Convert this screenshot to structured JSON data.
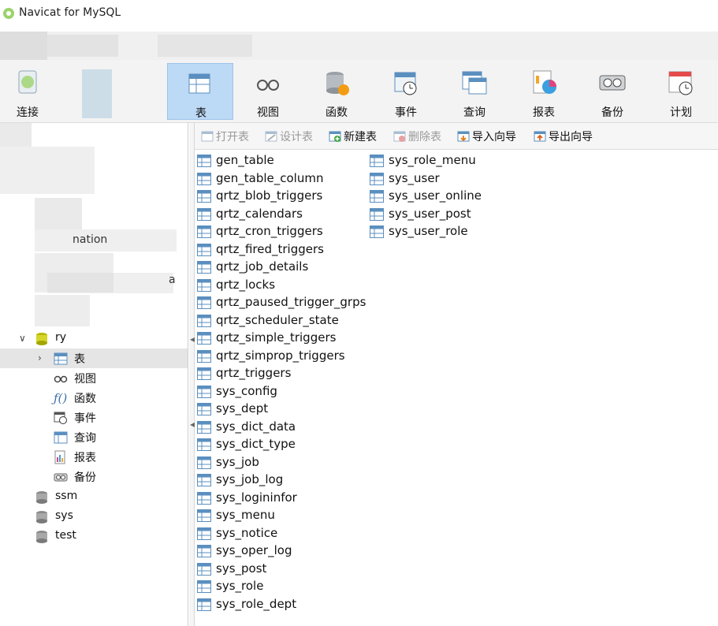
{
  "window": {
    "title": "Navicat for MySQL"
  },
  "toolbar": {
    "items": [
      {
        "label": "连接",
        "icon": "connection-icon"
      },
      {
        "label": "",
        "icon": "user-icon"
      },
      {
        "label": "表",
        "icon": "table-icon"
      },
      {
        "label": "视图",
        "icon": "view-icon"
      },
      {
        "label": "函数",
        "icon": "function-icon"
      },
      {
        "label": "事件",
        "icon": "event-icon"
      },
      {
        "label": "查询",
        "icon": "query-icon"
      },
      {
        "label": "报表",
        "icon": "report-icon"
      },
      {
        "label": "备份",
        "icon": "backup-icon"
      },
      {
        "label": "计划",
        "icon": "schedule-icon"
      }
    ]
  },
  "objbar": {
    "open": "打开表",
    "design": "设计表",
    "new": "新建表",
    "delete": "删除表",
    "import": "导入向导",
    "export": "导出向导"
  },
  "sidebar": {
    "partial_labels": [
      "nation",
      "a"
    ],
    "db_ry": "ry",
    "children": [
      {
        "label": "表",
        "icon": "table-icon"
      },
      {
        "label": "视图",
        "icon": "view-icon"
      },
      {
        "label": "函数",
        "icon": "function-icon"
      },
      {
        "label": "事件",
        "icon": "event-icon"
      },
      {
        "label": "查询",
        "icon": "query-icon"
      },
      {
        "label": "报表",
        "icon": "report-icon"
      },
      {
        "label": "备份",
        "icon": "backup-icon"
      }
    ],
    "other_dbs": [
      "ssm",
      "sys",
      "test"
    ]
  },
  "tables": {
    "col1": [
      "gen_table",
      "gen_table_column",
      "qrtz_blob_triggers",
      "qrtz_calendars",
      "qrtz_cron_triggers",
      "qrtz_fired_triggers",
      "qrtz_job_details",
      "qrtz_locks",
      "qrtz_paused_trigger_grps",
      "qrtz_scheduler_state",
      "qrtz_simple_triggers",
      "qrtz_simprop_triggers",
      "qrtz_triggers",
      "sys_config",
      "sys_dept",
      "sys_dict_data",
      "sys_dict_type",
      "sys_job",
      "sys_job_log",
      "sys_logininfor",
      "sys_menu",
      "sys_notice",
      "sys_oper_log",
      "sys_post",
      "sys_role",
      "sys_role_dept"
    ],
    "col2": [
      "sys_role_menu",
      "sys_user",
      "sys_user_online",
      "sys_user_post",
      "sys_user_role"
    ]
  },
  "colors": {
    "selected_tool": "#bcd9f5",
    "selected_row": "#e5e5e5",
    "table_icon": "#5b8fbf"
  }
}
